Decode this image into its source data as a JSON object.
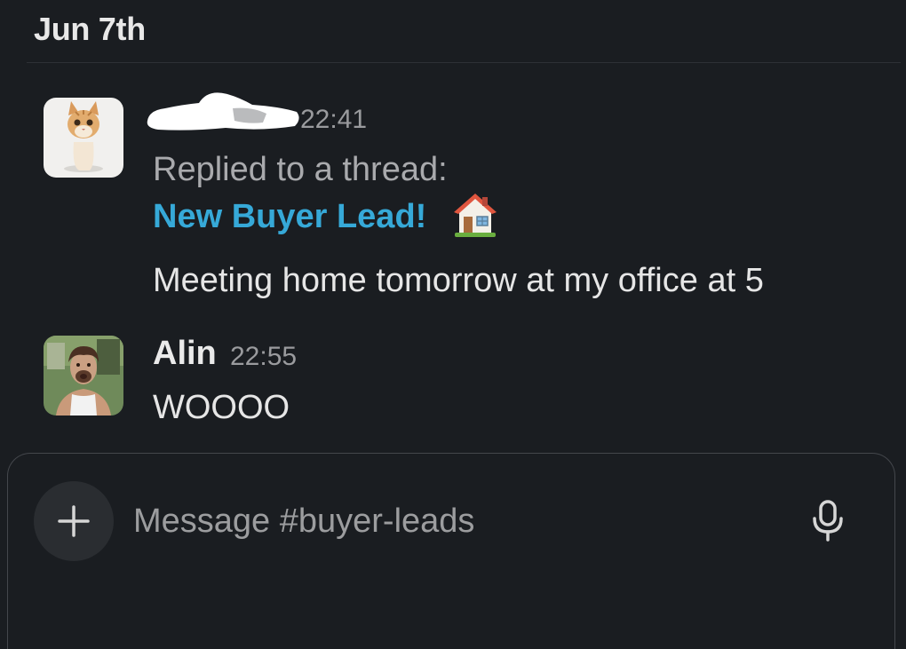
{
  "date_divider": "Jun 7th",
  "messages": [
    {
      "sender": "",
      "time": "22:41",
      "replied_label": "Replied to a thread:",
      "thread_title": "New Buyer Lead!",
      "text": "Meeting home tomorrow at my office at 5",
      "avatar_icon": "kitten-avatar"
    },
    {
      "sender": "Alin",
      "time": "22:55",
      "text": "WOOOO",
      "avatar_icon": "person-avatar"
    }
  ],
  "composer": {
    "placeholder": "Message #buyer-leads",
    "value": "",
    "add_icon": "plus-icon",
    "mic_icon": "microphone-icon"
  },
  "colors": {
    "background": "#1a1d21",
    "link": "#36a9d8",
    "muted": "#9a9b9e"
  }
}
